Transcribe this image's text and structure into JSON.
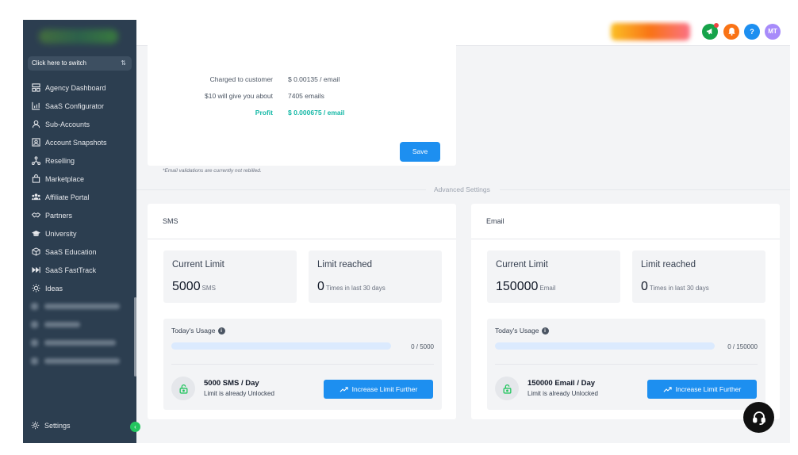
{
  "sidebar": {
    "switcher_label": "Click here to switch",
    "items": [
      {
        "label": "Agency Dashboard",
        "icon": "dashboard-icon"
      },
      {
        "label": "SaaS Configurator",
        "icon": "chart-icon"
      },
      {
        "label": "Sub-Accounts",
        "icon": "user-icon"
      },
      {
        "label": "Account Snapshots",
        "icon": "snapshot-icon"
      },
      {
        "label": "Reselling",
        "icon": "reselling-icon"
      },
      {
        "label": "Marketplace",
        "icon": "bag-icon"
      },
      {
        "label": "Affiliate Portal",
        "icon": "users-icon"
      },
      {
        "label": "Partners",
        "icon": "handshake-icon"
      },
      {
        "label": "University",
        "icon": "graduation-icon"
      },
      {
        "label": "SaaS Education",
        "icon": "box-icon"
      },
      {
        "label": "SaaS FastTrack",
        "icon": "fast-forward-icon"
      },
      {
        "label": "Ideas",
        "icon": "lightbulb-icon"
      }
    ],
    "settings_label": "Settings"
  },
  "topbar": {
    "avatar_initials": "MT",
    "help_label": "?"
  },
  "pricing": {
    "rows": [
      {
        "label": "Charged to customer",
        "value": "$ 0.00135 / email"
      },
      {
        "label": "$10 will give you about",
        "value": "7405 emails"
      },
      {
        "label": "Profit",
        "value": "$ 0.000675 / email"
      }
    ],
    "save_label": "Save",
    "note": "*Email validations are currently not rebilled."
  },
  "advanced_settings_label": "Advanced Settings",
  "sms": {
    "title": "SMS",
    "current_limit_title": "Current Limit",
    "current_limit_value": "5000",
    "current_limit_unit": "SMS",
    "limit_reached_title": "Limit reached",
    "limit_reached_value": "0",
    "limit_reached_unit": "Times in last 30 days",
    "usage_title": "Today's Usage",
    "usage_text": "0 / 5000",
    "usage_fraction": 0,
    "unlock_title": "5000 SMS / Day",
    "unlock_sub": "Limit is already Unlocked",
    "increase_label": "Increase Limit Further"
  },
  "email": {
    "title": "Email",
    "current_limit_title": "Current Limit",
    "current_limit_value": "150000",
    "current_limit_unit": "Email",
    "limit_reached_title": "Limit reached",
    "limit_reached_value": "0",
    "limit_reached_unit": "Times in last 30 days",
    "usage_title": "Today's Usage",
    "usage_text": "0 / 150000",
    "usage_fraction": 0,
    "unlock_title": "150000 Email / Day",
    "unlock_sub": "Limit is already Unlocked",
    "increase_label": "Increase Limit Further"
  },
  "colors": {
    "sidebar_bg": "#2c3e50",
    "accent": "#1d8ff0",
    "profit": "#14b8a6",
    "page_bg": "#f3f4f6"
  }
}
